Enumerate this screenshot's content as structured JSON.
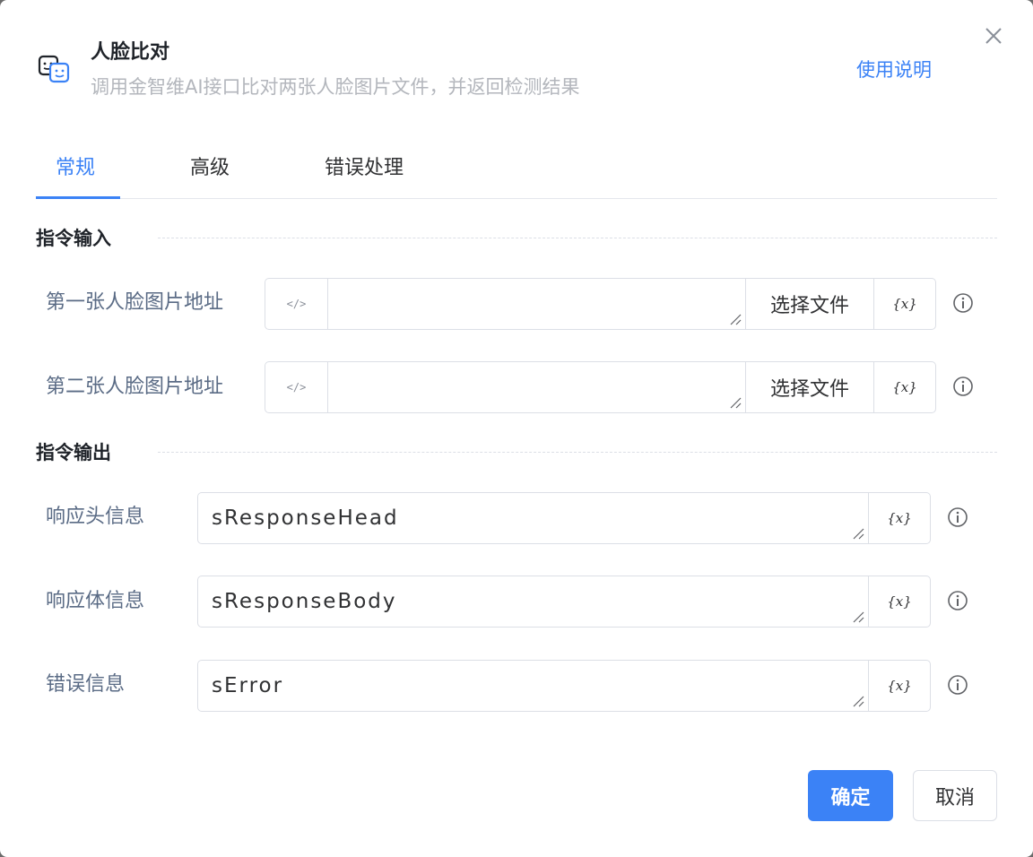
{
  "header": {
    "title": "人脸比对",
    "subtitle": "调用金智维AI接口比对两张人脸图片文件，并返回检测结果",
    "help_link": "使用说明",
    "icon": "face-compare-icon",
    "close_icon": "close-icon"
  },
  "tabs": [
    {
      "label": "常规",
      "active": true
    },
    {
      "label": "高级",
      "active": false
    },
    {
      "label": "错误处理",
      "active": false
    }
  ],
  "sections": {
    "input_title": "指令输入",
    "output_title": "指令输出"
  },
  "inputs": [
    {
      "label": "第一张人脸图片地址",
      "value": "",
      "prefix": "</>",
      "file_button": "选择文件",
      "var_button": "{x}"
    },
    {
      "label": "第二张人脸图片地址",
      "value": "",
      "prefix": "</>",
      "file_button": "选择文件",
      "var_button": "{x}"
    }
  ],
  "outputs": [
    {
      "label": "响应头信息",
      "value": "sResponseHead",
      "var_button": "{x}"
    },
    {
      "label": "响应体信息",
      "value": "sResponseBody",
      "var_button": "{x}"
    },
    {
      "label": "错误信息",
      "value": "sError",
      "var_button": "{x}"
    }
  ],
  "footer": {
    "confirm": "确定",
    "cancel": "取消"
  },
  "colors": {
    "accent": "#3b82f6",
    "label": "#5a6b85",
    "subtitle": "#b3b6bc"
  }
}
